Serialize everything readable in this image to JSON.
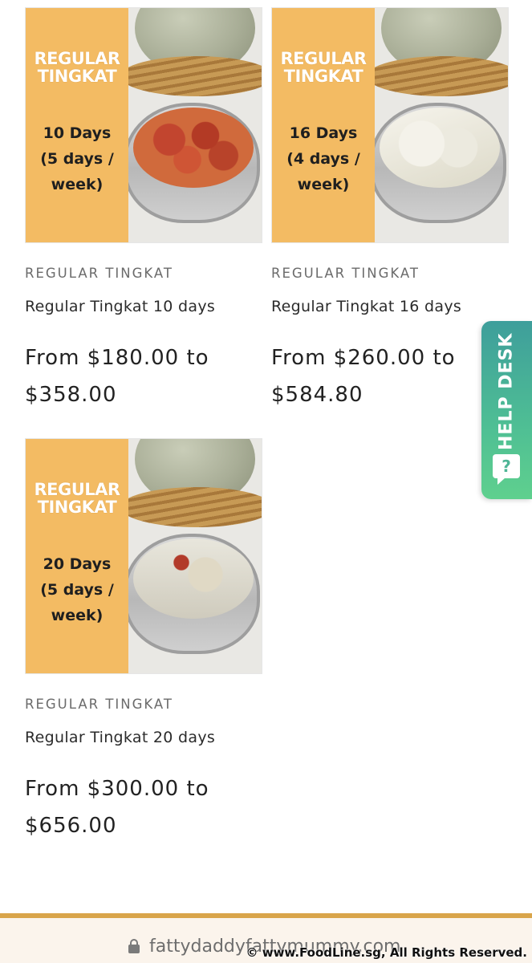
{
  "products": [
    {
      "band_title_line1": "REGULAR",
      "band_title_line2": "TINGKAT",
      "band_days_line1": "10 Days",
      "band_days_line2": "(5 days /",
      "band_days_line3": "week)",
      "vendor": "REGULAR TINGKAT",
      "title": "Regular Tingkat 10 days",
      "price_line1": "From $180.00 to",
      "price_line2": "$358.00"
    },
    {
      "band_title_line1": "REGULAR",
      "band_title_line2": "TINGKAT",
      "band_days_line1": "16 Days",
      "band_days_line2": "(4 days /",
      "band_days_line3": "week)",
      "vendor": "REGULAR TINGKAT",
      "title": "Regular Tingkat 16 days",
      "price_line1": "From $260.00 to",
      "price_line2": "$584.80"
    },
    {
      "band_title_line1": "REGULAR",
      "band_title_line2": "TINGKAT",
      "band_days_line1": "20 Days",
      "band_days_line2": "(5 days /",
      "band_days_line3": "week)",
      "vendor": "REGULAR TINGKAT",
      "title": "Regular Tingkat 20 days",
      "price_line1": "From $300.00 to",
      "price_line2": "$656.00"
    }
  ],
  "help_desk": {
    "label": "HELP DESK",
    "icon": "question-chat-icon",
    "icon_glyph": "?"
  },
  "browser": {
    "url": "fattydaddyfattymummy.com"
  },
  "watermark": {
    "text": "© www.FoodLine.sg, All Rights Reserved."
  },
  "colors": {
    "band": "#f3bb63",
    "help_desk_top": "#3e9e9b",
    "help_desk_bottom": "#5fd08e",
    "footer_line": "#d9a54a"
  }
}
